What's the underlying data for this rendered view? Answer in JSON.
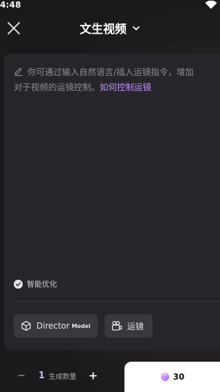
{
  "status_bar": {
    "time": "4:48"
  },
  "header": {
    "title": "文生视频"
  },
  "prompt": {
    "line1": "你可通过输入自然语言/插入运镜指令，增加",
    "line2": "对于视频的运镜控制。",
    "link": "如何控制运镜"
  },
  "options": {
    "optimize_label": "智能优化"
  },
  "chips": {
    "director_label": "Director",
    "director_sub": "Model",
    "camera_label": "运镜"
  },
  "bottom": {
    "quantity": "1",
    "quantity_label": "生成数量",
    "credits": "30"
  },
  "colors": {
    "accent": "#c58cff",
    "background": "#1a1a1d",
    "card": "#26262a"
  }
}
